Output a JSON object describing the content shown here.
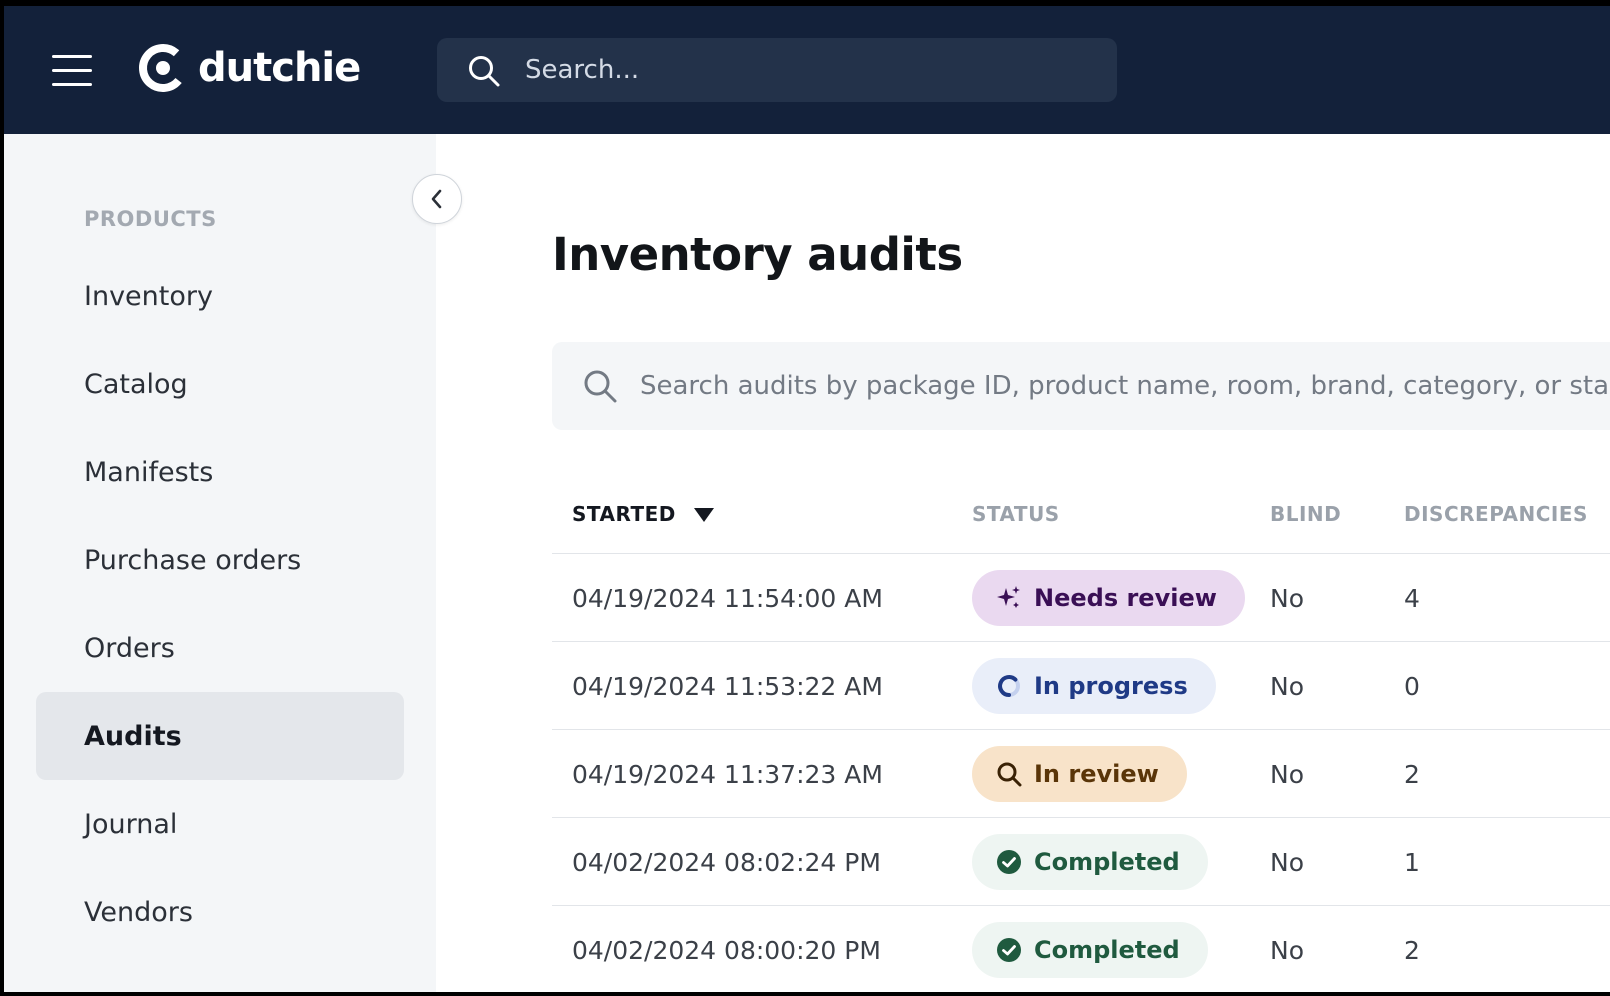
{
  "header": {
    "brand": "dutchie",
    "search_placeholder": "Search..."
  },
  "sidebar": {
    "section": "PRODUCTS",
    "items": [
      {
        "label": "Inventory"
      },
      {
        "label": "Catalog"
      },
      {
        "label": "Manifests"
      },
      {
        "label": "Purchase orders"
      },
      {
        "label": "Orders"
      },
      {
        "label": "Audits",
        "active": true
      },
      {
        "label": "Journal"
      },
      {
        "label": "Vendors"
      }
    ]
  },
  "main": {
    "title": "Inventory audits",
    "search_placeholder": "Search audits by package ID, product name, room, brand, category, or started by",
    "columns": [
      "STARTED",
      "STATUS",
      "BLIND",
      "DISCREPANCIES"
    ],
    "rows": [
      {
        "started": "04/19/2024 11:54:00 AM",
        "status": "Needs review",
        "blind": "No",
        "discrepancies": "4"
      },
      {
        "started": "04/19/2024 11:53:22 AM",
        "status": "In progress",
        "blind": "No",
        "discrepancies": "0"
      },
      {
        "started": "04/19/2024 11:37:23 AM",
        "status": "In review",
        "blind": "No",
        "discrepancies": "2"
      },
      {
        "started": "04/02/2024 08:02:24 PM",
        "status": "Completed",
        "blind": "No",
        "discrepancies": "1"
      },
      {
        "started": "04/02/2024 08:00:20 PM",
        "status": "Completed",
        "blind": "No",
        "discrepancies": "2"
      }
    ]
  },
  "colors": {
    "topbar": "#13213a",
    "needs_review_bg": "#ead9f0",
    "needs_review_fg": "#3a0f55",
    "in_progress_bg": "#e9eef9",
    "in_progress_fg": "#1f3a86",
    "in_review_bg": "#f8e3c9",
    "in_review_fg": "#5a3508",
    "completed_bg": "#eef5f2",
    "completed_fg": "#1f5a3f"
  }
}
